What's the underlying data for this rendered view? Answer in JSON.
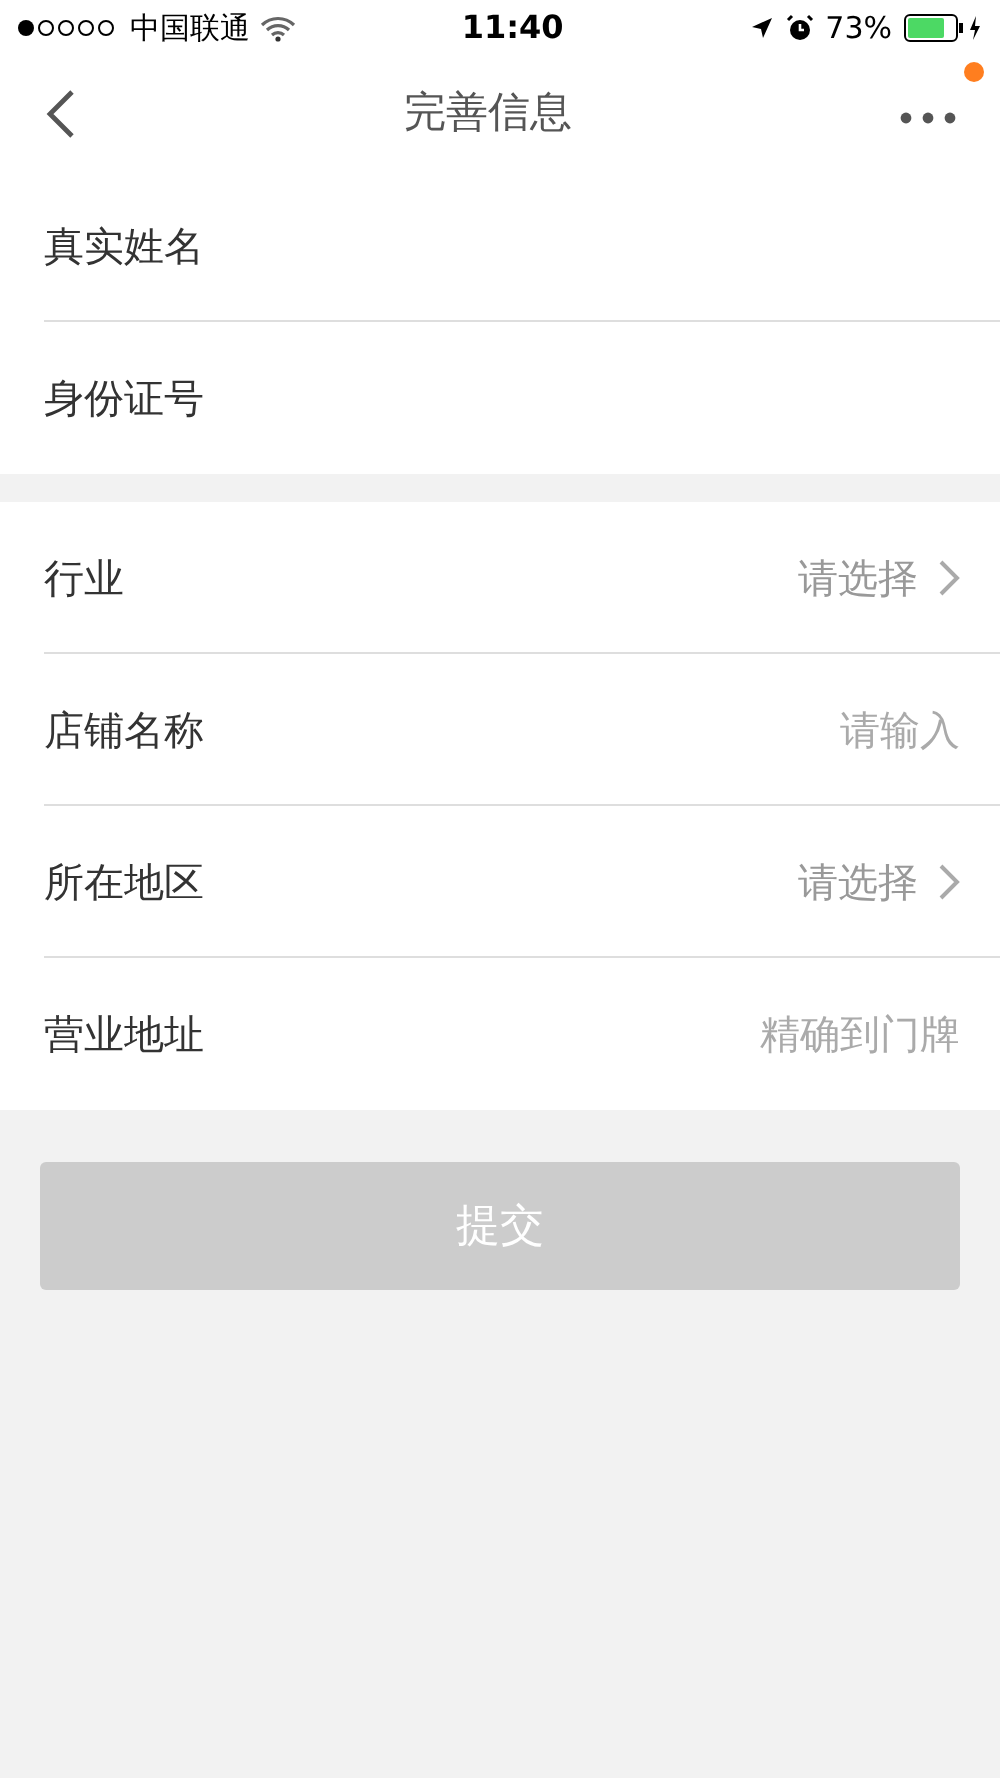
{
  "status_bar": {
    "carrier": "中国联通",
    "time": "11:40",
    "battery_text": "73%"
  },
  "nav": {
    "title": "完善信息",
    "more_has_notification": true
  },
  "sections": [
    {
      "fields": [
        {
          "kind": "input",
          "label": "真实姓名"
        },
        {
          "kind": "input",
          "label": "身份证号"
        }
      ]
    },
    {
      "fields": [
        {
          "kind": "select",
          "label": "行业",
          "placeholder": "请选择"
        },
        {
          "kind": "input",
          "label": "店铺名称",
          "placeholder": "请输入"
        },
        {
          "kind": "select",
          "label": "所在地区",
          "placeholder": "请选择"
        },
        {
          "kind": "input",
          "label": "营业地址",
          "placeholder": "精确到门牌"
        }
      ]
    }
  ],
  "submit": {
    "label": "提交",
    "disabled": true
  }
}
